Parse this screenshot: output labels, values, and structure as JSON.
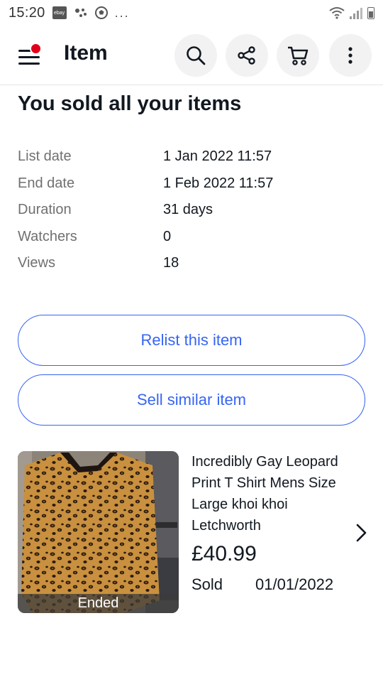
{
  "status_bar": {
    "time": "15:20",
    "ebay_badge": "ebay",
    "extra": "..."
  },
  "app_bar": {
    "title": "Item",
    "icons": [
      "menu-icon",
      "search-icon",
      "share-icon",
      "cart-icon",
      "more-icon"
    ]
  },
  "headline": "You sold all your items",
  "details": [
    {
      "label": "List date",
      "value": "1 Jan 2022 11:57"
    },
    {
      "label": "End date",
      "value": "1 Feb 2022 11:57"
    },
    {
      "label": "Duration",
      "value": "31 days"
    },
    {
      "label": "Watchers",
      "value": "0"
    },
    {
      "label": "Views",
      "value": "18"
    }
  ],
  "buttons": {
    "relist": "Relist this item",
    "sell_similar": "Sell similar item"
  },
  "item": {
    "title": "Incredibly Gay Leopard Print T Shirt Mens Size Large khoi khoi Letchworth",
    "price": "£40.99",
    "status": "Sold",
    "date": "01/01/2022",
    "badge": "Ended"
  },
  "colors": {
    "accent": "#3665f3",
    "notification": "#e0001b",
    "text": "#111820",
    "muted": "#707070"
  }
}
